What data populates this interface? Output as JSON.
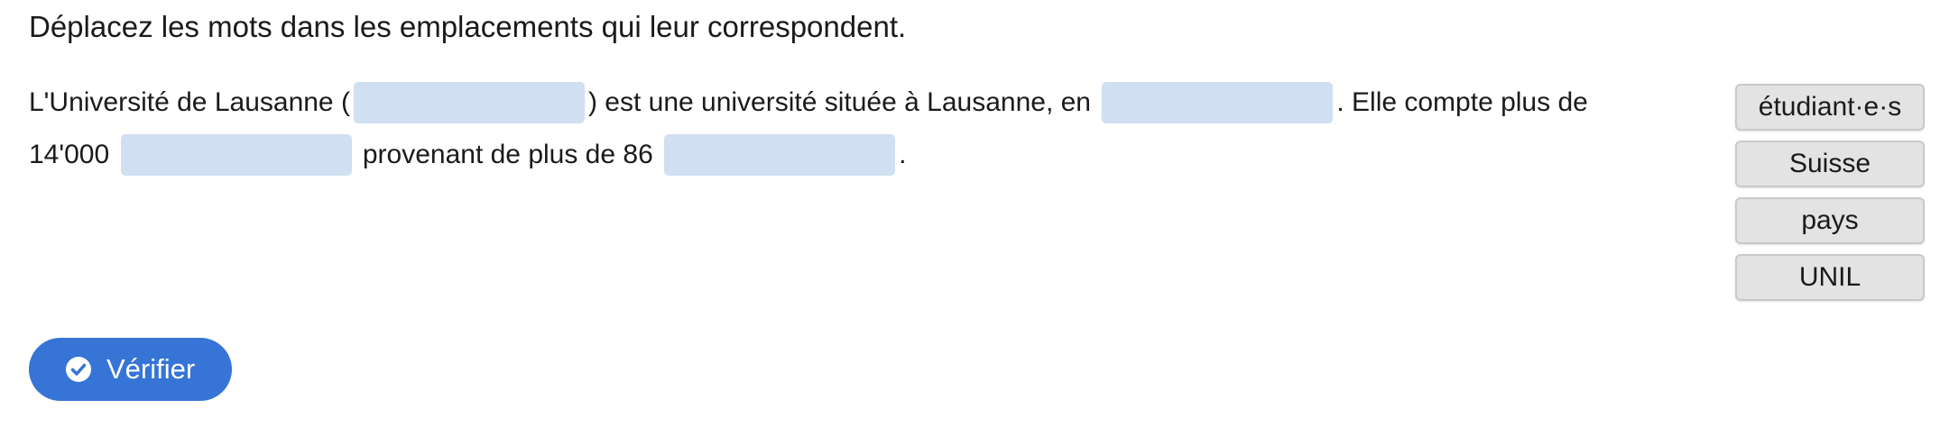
{
  "instruction": "Déplacez les mots dans les emplacements qui leur correspondent.",
  "text": {
    "seg1": "L'Université de Lausanne (",
    "seg2": ") est une université située à Lausanne, en",
    "seg3": ". Elle compte plus de",
    "seg4": "14'000",
    "seg5": "provenant de plus de 86",
    "seg6": "."
  },
  "word_bank": [
    "étudiant·e·s",
    "Suisse",
    "pays",
    "UNIL"
  ],
  "verify_button": {
    "label": "Vérifier",
    "icon": "check-circle-icon"
  },
  "colors": {
    "dropzone": "#d0dff2",
    "word_bg": "#e3e3e3",
    "button": "#3674d6"
  }
}
